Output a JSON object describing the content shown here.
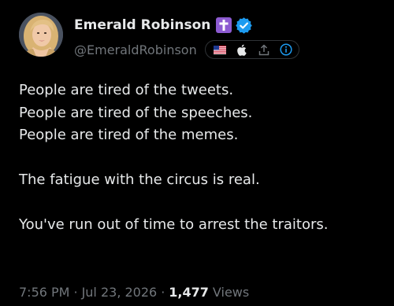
{
  "author": {
    "display_name": "Emerald Robinson",
    "handle": "@EmeraldRobinson",
    "badge_color": "#8d5bd1",
    "verified_color": "#1d9bf0"
  },
  "profile_icons": [
    "us-flag-icon",
    "apple-icon",
    "upload-icon",
    "info-icon"
  ],
  "tweet": {
    "line1": "People are tired of the tweets.",
    "line2": "People are tired of the speeches.",
    "line3": "People are tired of the memes.",
    "line4": "The fatigue with the circus is real.",
    "line5": "You've run out of time to arrest the traitors."
  },
  "meta": {
    "time": "7:56 PM",
    "date": "Jul 23, 2026",
    "views_count": "1,477",
    "views_label": "Views",
    "separator": "·"
  }
}
